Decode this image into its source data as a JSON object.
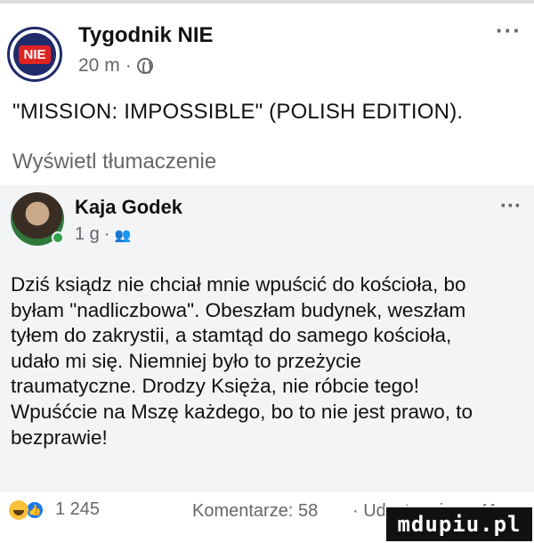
{
  "post": {
    "page_name": "Tygodnik NIE",
    "avatar_badge": "NIE",
    "time": "20 m",
    "separator": "·",
    "more": "···",
    "text": "\"MISSION: IMPOSSIBLE\" (POLISH EDITION).",
    "translate": "Wyświetl tłumaczenie"
  },
  "comment": {
    "author": "Kaja Godek",
    "time": "1 g",
    "separator": "·",
    "more": "···",
    "lines": [
      "Dziś ksiądz nie chciał mnie wpuścić do kościoła, bo",
      "byłam \"nadliczbowa\". Obeszłam budynek, weszłam",
      "tyłem do zakrystii, a stamtąd do samego kościoła,",
      "udało mi się. Niemniej było to przeżycie",
      "traumatyczne. Drodzy Księża, nie róbcie tego!",
      "Wpuśćcie na Mszę każdego, bo to nie jest prawo, to",
      "bezprawie!"
    ]
  },
  "footer": {
    "reaction_count": "1 245",
    "comments": "Komentarze: 58",
    "separator": "·",
    "shares": "Udostępniono 41 razy"
  },
  "watermark": "mdupiu.pl",
  "icons": {
    "globe": "globe-icon",
    "friends": "friends-icon",
    "haha": "haha-reaction-icon",
    "like": "like-reaction-icon"
  },
  "colors": {
    "secondary_text": "#65676b",
    "comment_background": "#f3f4f6",
    "like_blue": "#1877f2",
    "online_green": "#31a24c"
  }
}
